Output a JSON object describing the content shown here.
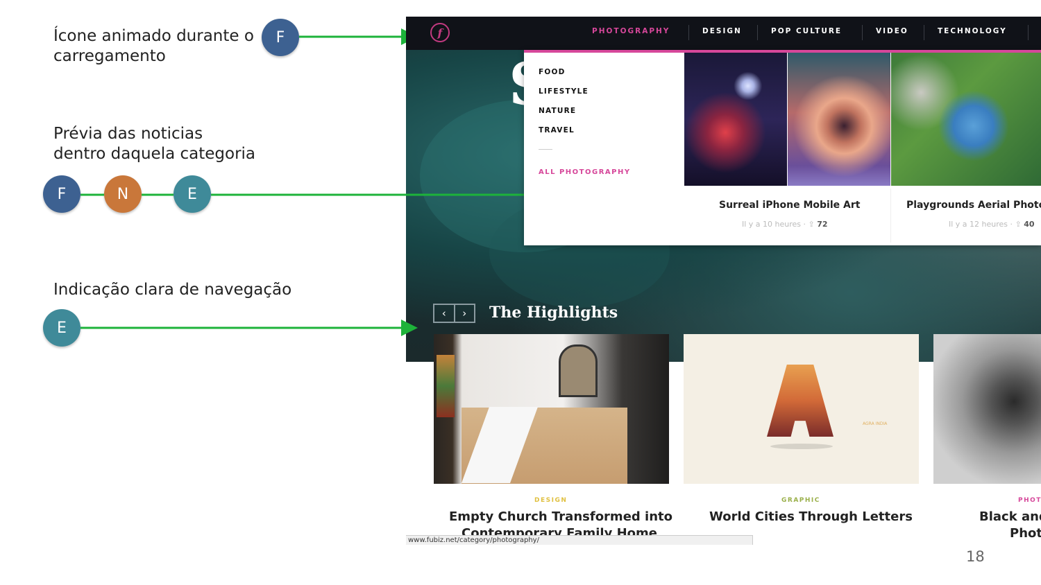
{
  "annotations": {
    "loading": {
      "text_line1": "Ícone animado durante o",
      "text_line2": "carregamento",
      "badge": "F"
    },
    "preview": {
      "text_line1": "Prévia das noticias",
      "text_line2": "dentro daquela categoria",
      "badges": [
        "F",
        "N",
        "E"
      ]
    },
    "navigation": {
      "text": "Indicação clara de navegação",
      "badge": "E"
    }
  },
  "colors": {
    "arrow": "#1db33a",
    "badge_F": "#3d6191",
    "badge_N": "#c9773a",
    "badge_E": "#3f8a99",
    "accent": "#d6479a"
  },
  "site": {
    "logo": "f",
    "nav": [
      "PHOTOGRAPHY",
      "DESIGN",
      "POP CULTURE",
      "VIDEO",
      "TECHNOLOGY"
    ],
    "hero_letter": "S",
    "dropdown": {
      "subcategories": [
        "FOOD",
        "LIFESTYLE",
        "NATURE",
        "TRAVEL"
      ],
      "all_link": "ALL PHOTOGRAPHY",
      "articles": [
        {
          "title": "Surreal iPhone Mobile Art",
          "time": "Il y a 10 heures",
          "shares": "72"
        },
        {
          "title": "Playgrounds Aerial Photo",
          "time": "Il y a 12 heures",
          "shares": "40"
        }
      ]
    },
    "highlights": {
      "title": "The Highlights",
      "prev": "‹",
      "next": "›",
      "cards": [
        {
          "category": "DESIGN",
          "title_line1": "Empty Church Transformed into",
          "title_line2": "Contemporary Family Home"
        },
        {
          "category": "GRAPHIC",
          "title_line1": "World Cities Through Letters",
          "image_caption": "AGRA INDIA"
        },
        {
          "category": "PHOT",
          "title_line1": "Black and",
          "title_line2": "Phot"
        }
      ]
    },
    "status_url": "www.fubiz.net/category/photography/"
  },
  "page_number": "18"
}
